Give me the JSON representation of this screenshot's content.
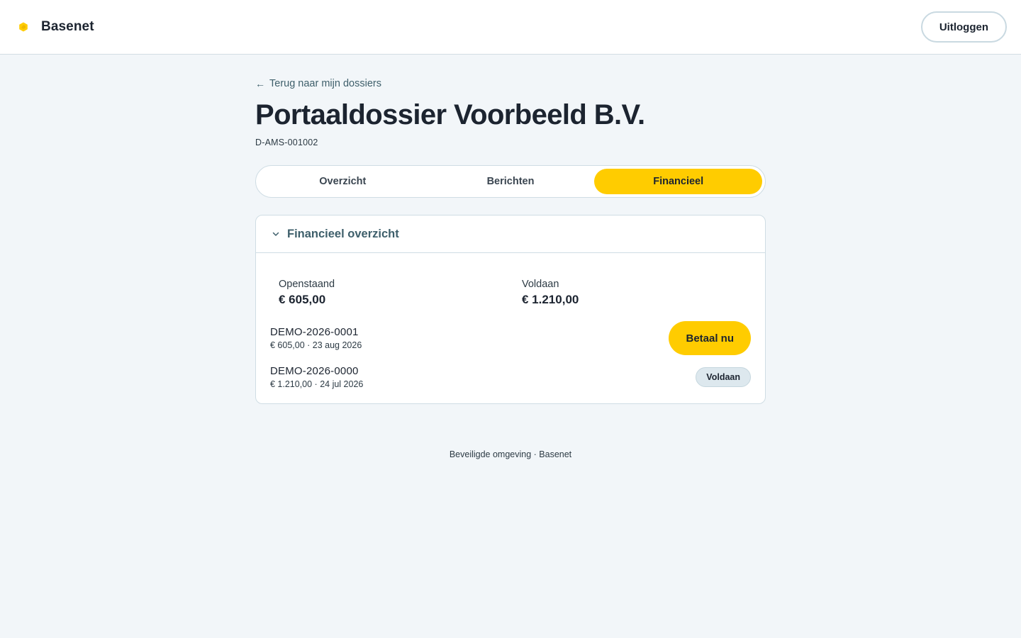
{
  "app": {
    "brand_name": "Basenet",
    "logout_label": "Uitloggen",
    "brand_color": "#ffcc00"
  },
  "page": {
    "back_link": "Terug naar mijn dossiers",
    "title": "Portaaldossier Voorbeeld B.V.",
    "dossier_id": "D-AMS-001002"
  },
  "tabs": [
    {
      "label": "Overzicht",
      "active": false
    },
    {
      "label": "Berichten",
      "active": false
    },
    {
      "label": "Financieel",
      "active": true
    }
  ],
  "financial": {
    "section_title": "Financieel overzicht",
    "open_label": "Openstaand",
    "open_value": "€ 605,00",
    "paid_label": "Voldaan",
    "paid_value": "€ 1.210,00",
    "invoices": [
      {
        "number": "DEMO-2026-0001",
        "meta": "€ 605,00 · 23 aug 2026",
        "action_label": "Betaal nu"
      },
      {
        "number": "DEMO-2026-0000",
        "meta": "€ 1.210,00 · 24 jul 2026",
        "status_label": "Voldaan"
      }
    ]
  },
  "footer": {
    "text": "Beveiligde omgeving · Basenet"
  },
  "icons": {
    "brand": "hexagon-logo-icon",
    "back": "arrow-left-icon",
    "collapse": "chevron-down-icon"
  }
}
